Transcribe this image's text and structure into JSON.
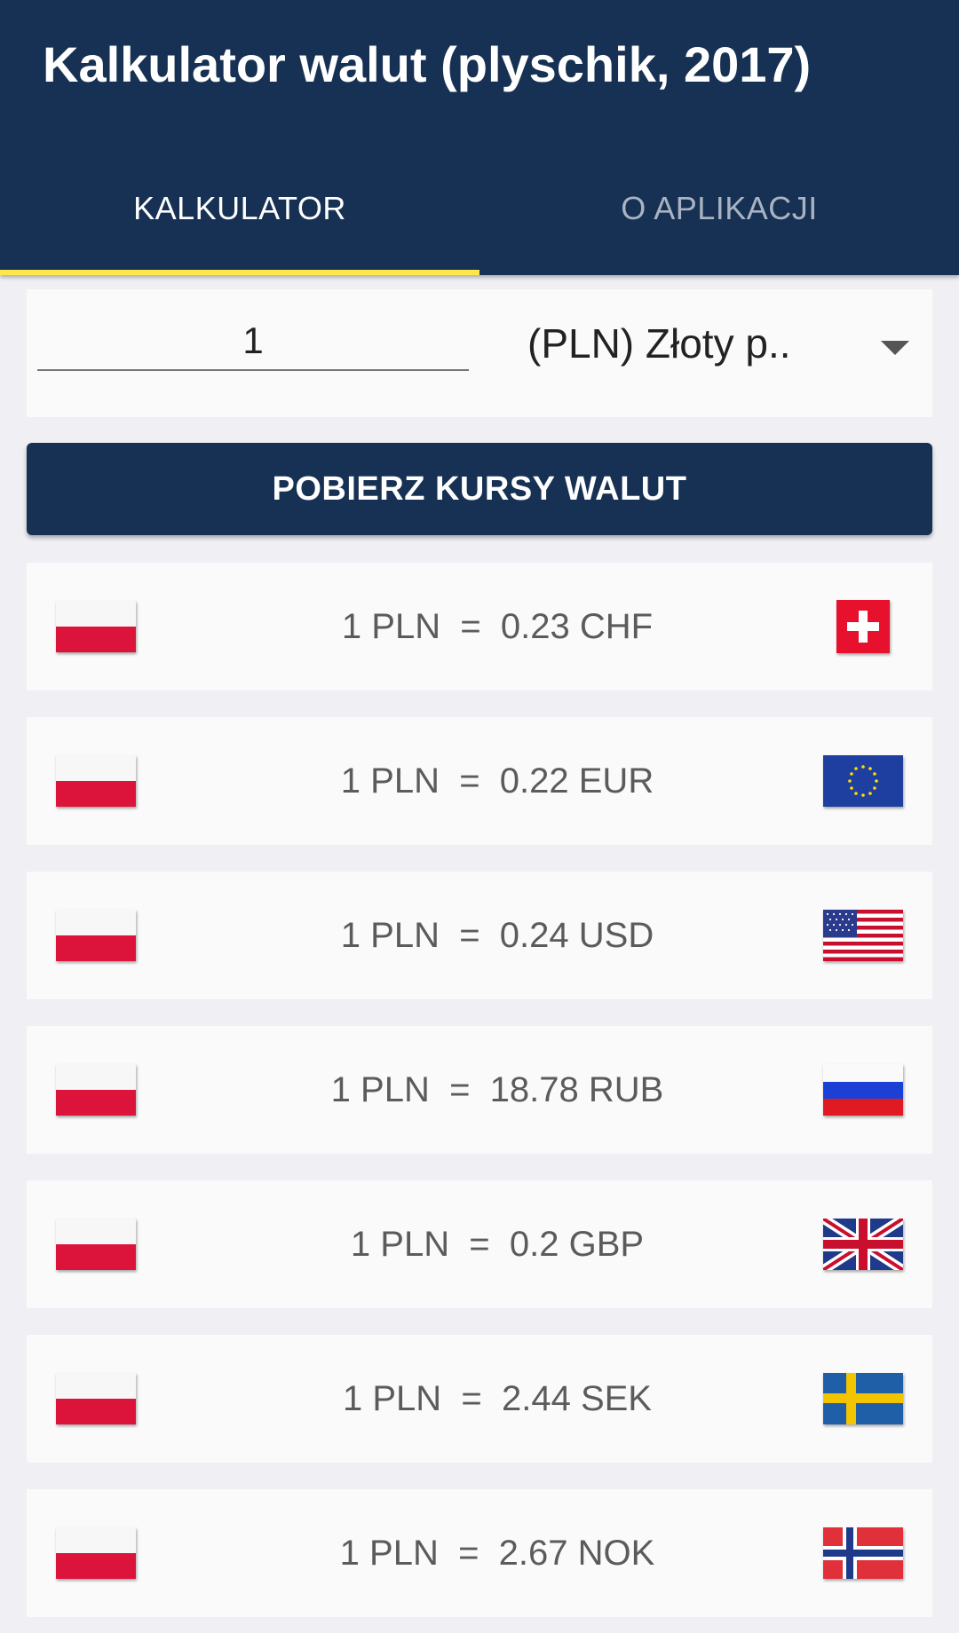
{
  "app": {
    "title": "Kalkulator walut (plyschik, 2017)"
  },
  "tabs": [
    {
      "label": "KALKULATOR",
      "active": true
    },
    {
      "label": "O APLIKACJI",
      "active": false
    }
  ],
  "converter": {
    "amount": "1",
    "currency": "(PLN) Złoty p.."
  },
  "fetch_button": {
    "label": "POBIERZ KURSY WALUT"
  },
  "rates": [
    {
      "text": "1 PLN  =  0.23 CHF",
      "base_flag": "poland-flag-icon",
      "target_flag": "switzerland-flag-icon"
    },
    {
      "text": "1 PLN  =  0.22 EUR",
      "base_flag": "poland-flag-icon",
      "target_flag": "eu-flag-icon"
    },
    {
      "text": "1 PLN  =  0.24 USD",
      "base_flag": "poland-flag-icon",
      "target_flag": "usa-flag-icon"
    },
    {
      "text": "1 PLN  =  18.78 RUB",
      "base_flag": "poland-flag-icon",
      "target_flag": "russia-flag-icon"
    },
    {
      "text": "1 PLN  =  0.2 GBP",
      "base_flag": "poland-flag-icon",
      "target_flag": "uk-flag-icon"
    },
    {
      "text": "1 PLN  =  2.44 SEK",
      "base_flag": "poland-flag-icon",
      "target_flag": "sweden-flag-icon"
    },
    {
      "text": "1 PLN  =  2.67 NOK",
      "base_flag": "poland-flag-icon",
      "target_flag": "norway-flag-icon"
    }
  ],
  "colors": {
    "primary": "#163153",
    "tab_indicator": "#ffe74a",
    "background": "#efeff4",
    "card": "#fafafa"
  }
}
